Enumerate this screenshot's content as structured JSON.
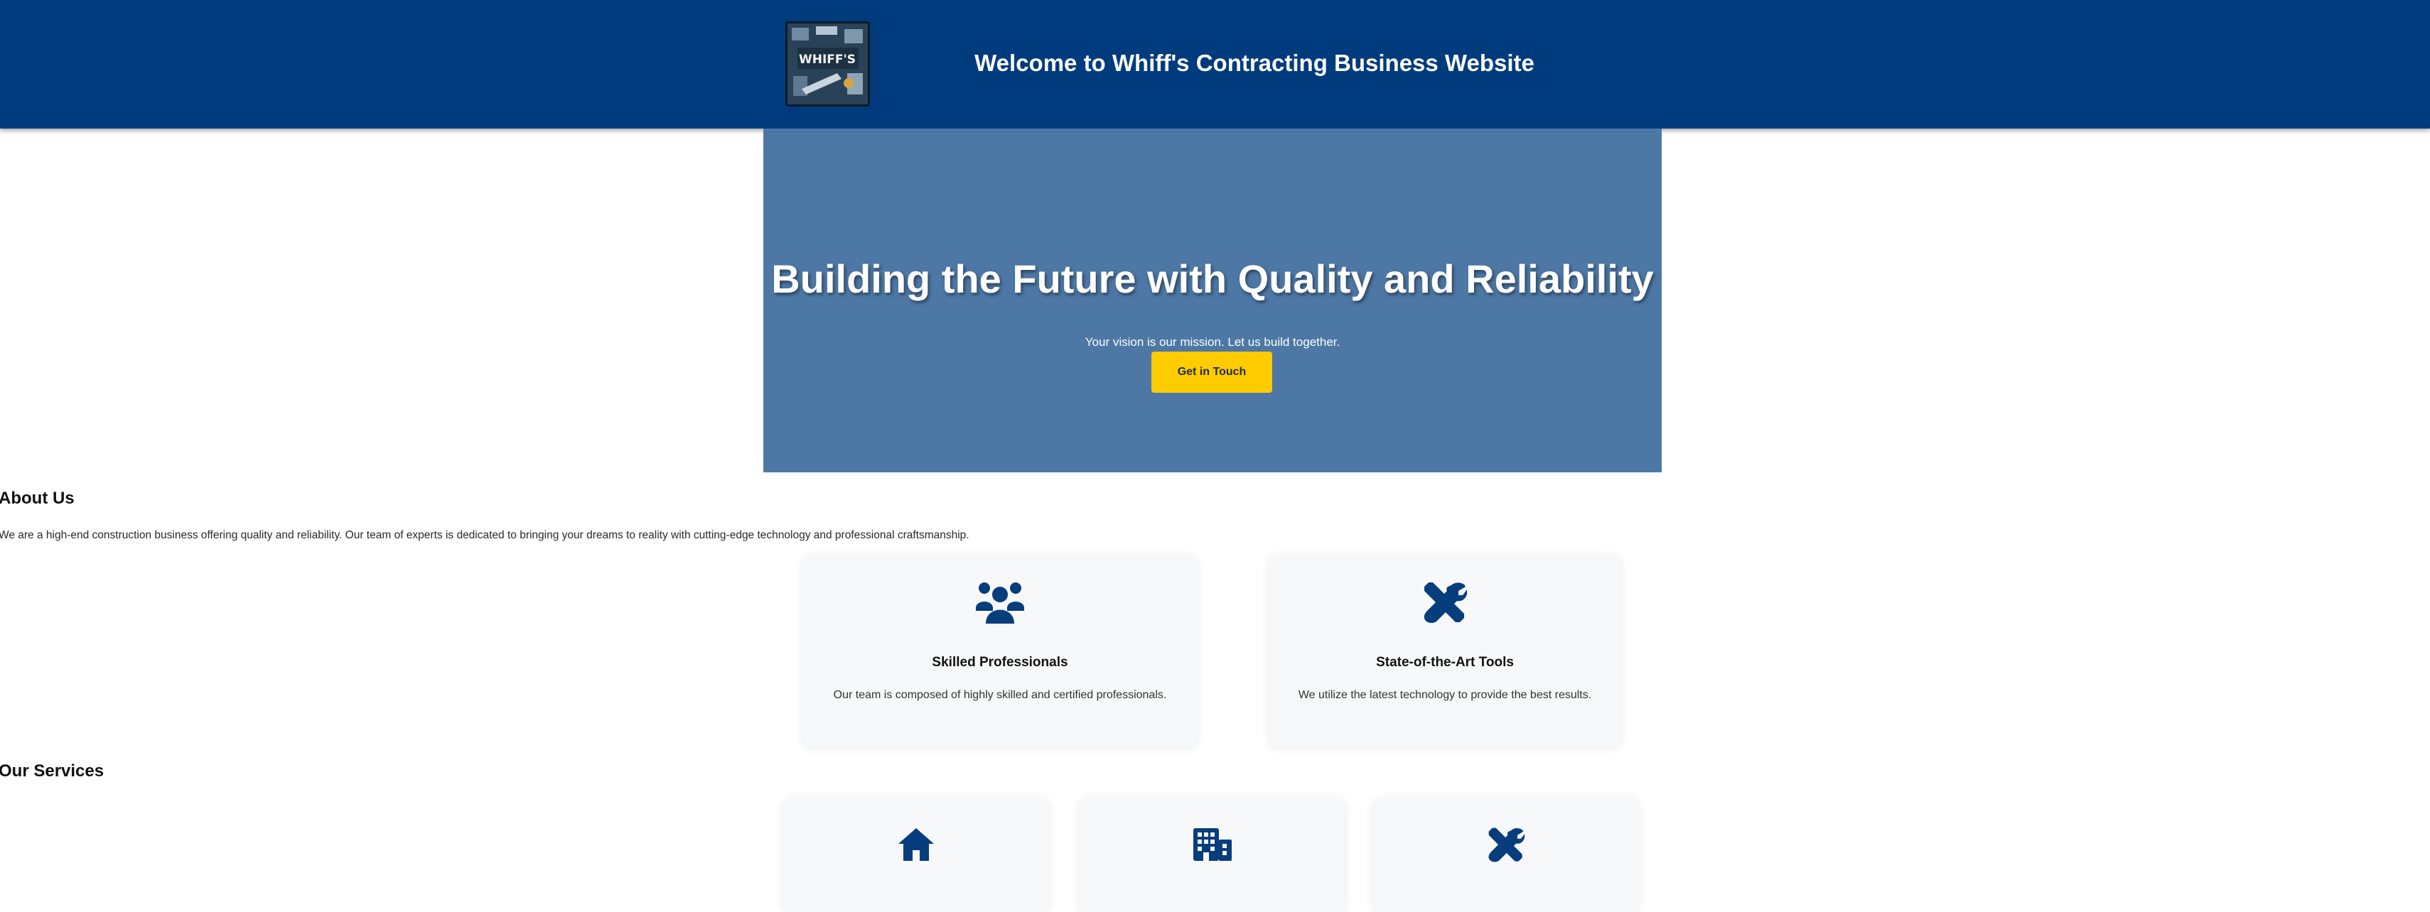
{
  "header": {
    "title": "Welcome to Whiff's Contracting Business Website",
    "logo_text": "WHIFF'S"
  },
  "hero": {
    "title": "Building the Future with Quality and Reliability",
    "subtitle": "Your vision is our mission. Let us build together.",
    "button_label": "Get in Touch"
  },
  "about": {
    "heading": "About Us",
    "text": "We are a high-end construction business offering quality and reliability. Our team of experts is dedicated to bringing your dreams to reality with cutting-edge technology and professional craftsmanship.",
    "features": [
      {
        "icon": "users-icon",
        "title": "Skilled Professionals",
        "text": "Our team is composed of highly skilled and certified professionals."
      },
      {
        "icon": "tools-icon",
        "title": "State-of-the-Art Tools",
        "text": "We utilize the latest technology to provide the best results."
      }
    ]
  },
  "services": {
    "heading": "Our Services",
    "items": [
      {
        "icon": "house-icon"
      },
      {
        "icon": "building-icon"
      },
      {
        "icon": "tools-icon"
      }
    ]
  },
  "colors": {
    "header_bg": "#003b7e",
    "hero_bg": "#4d77a5",
    "accent_button": "#ffcc00",
    "icon_color": "#063d7c"
  }
}
